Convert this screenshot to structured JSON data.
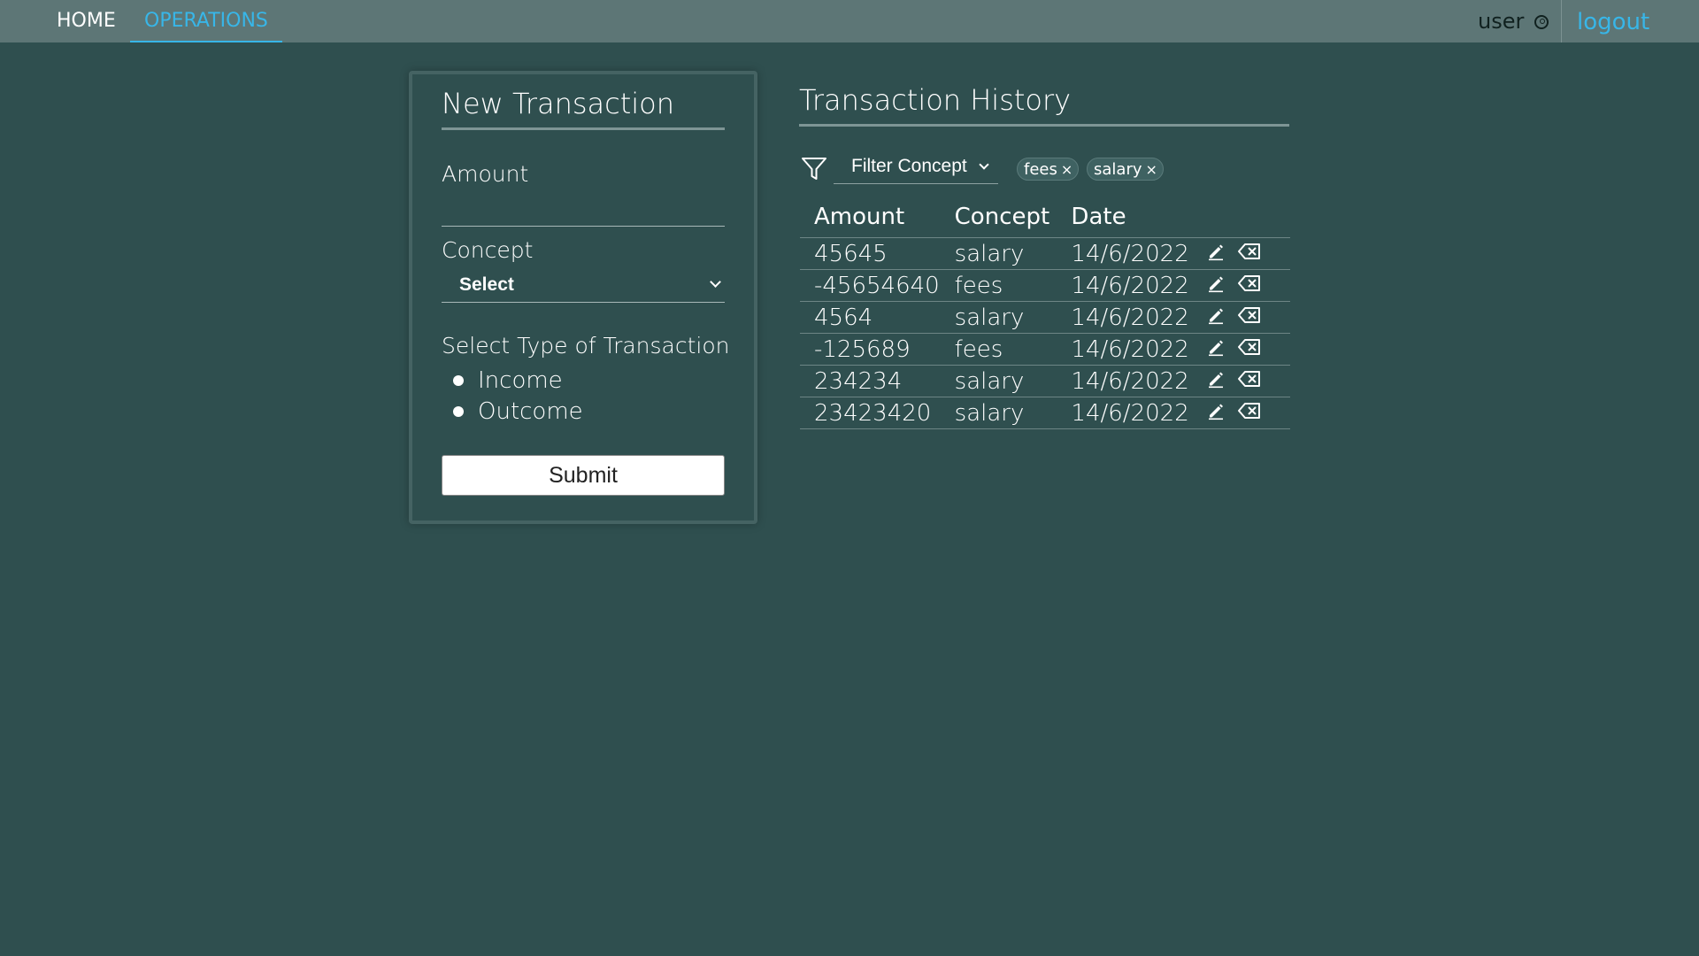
{
  "nav": {
    "home_label": "HOME",
    "operations_label": "OPERATIONS",
    "user_label": "user",
    "logout_label": "logout"
  },
  "new_transaction": {
    "title": "New Transaction",
    "amount_label": "Amount",
    "amount_value": "",
    "concept_label": "Concept",
    "concept_selected": "Select",
    "type_label": "Select Type of Transaction",
    "types": [
      "Income",
      "Outcome"
    ],
    "submit_label": "Submit"
  },
  "history": {
    "title": "Transaction History",
    "filter_label": "Filter Concept",
    "chips": [
      "fees",
      "salary"
    ],
    "columns": [
      "Amount",
      "Concept",
      "Date"
    ],
    "rows": [
      {
        "amount": "45645",
        "concept": "salary",
        "date": "14/6/2022",
        "sign": "positive"
      },
      {
        "amount": "-45654640",
        "concept": "fees",
        "date": "14/6/2022",
        "sign": "negative"
      },
      {
        "amount": "4564",
        "concept": "salary",
        "date": "14/6/2022",
        "sign": "positive"
      },
      {
        "amount": "-125689",
        "concept": "fees",
        "date": "14/6/2022",
        "sign": "negative"
      },
      {
        "amount": "234234",
        "concept": "salary",
        "date": "14/6/2022",
        "sign": "positive"
      },
      {
        "amount": "23423420",
        "concept": "salary",
        "date": "14/6/2022",
        "sign": "positive"
      }
    ]
  },
  "colors": {
    "background": "#2f4f4f",
    "navbar": "#5d7676",
    "accent": "#38b6e8",
    "positive": "#8ec24a",
    "negative": "#e0373a"
  }
}
